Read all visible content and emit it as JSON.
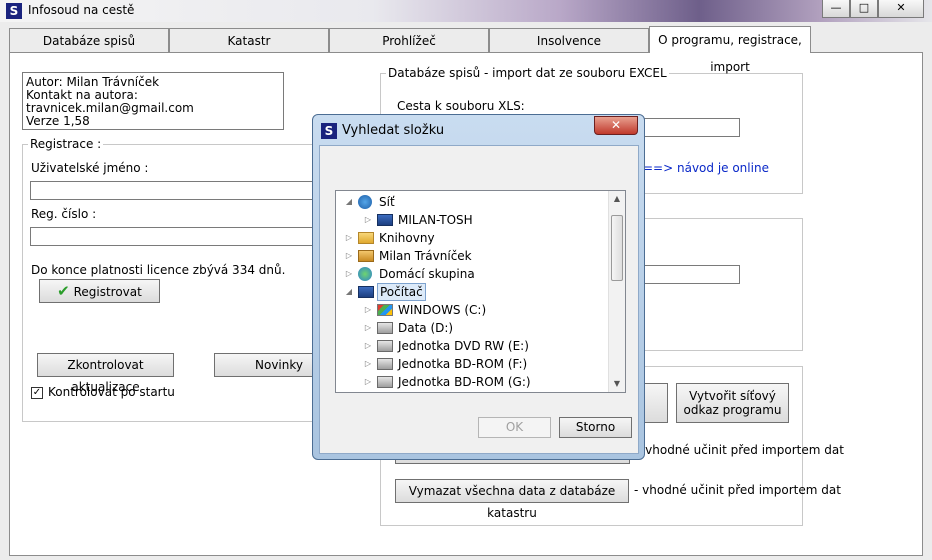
{
  "window": {
    "title": "Infosoud na cestě",
    "minimize": "—",
    "maximize": "□",
    "close": "✕"
  },
  "tabs": [
    {
      "label": "Databáze spisů"
    },
    {
      "label": "Katastr"
    },
    {
      "label": "Prohlížeč"
    },
    {
      "label": "Insolvence"
    },
    {
      "label": "O programu, registrace, import"
    }
  ],
  "about": {
    "line1": "Autor: Milan Trávníček",
    "line2": "Kontakt na autora: travnicek.milan@gmail.com",
    "line3": "Verze 1,58"
  },
  "registration": {
    "group_label": "Registrace :",
    "username_label": "Uživatelské jméno :",
    "username_value": "",
    "regnum_label": "Reg. číslo :",
    "regnum_value": "",
    "license_text": "Do konce platnosti licence zbývá 334 dnů.",
    "register_button": "Registrovat"
  },
  "updates": {
    "check_button": "Zkontrolovat aktualizace",
    "news_button": "Novinky",
    "check_on_start_label": "Kontrolovat po startu",
    "check_on_start": true
  },
  "import": {
    "group_label": "Databáze spisů - import dat ze souboru EXCEL",
    "path_label": "Cesta k souboru XLS:",
    "path_value": "",
    "help_link": "==> návod je online",
    "second_value": "",
    "network_link_button": "Vytvořit síťový odkaz programu",
    "hint_text": "- vhodné učinit před importem dat",
    "clear_cadastre_button": "Vymazat všechna data z databáze katastru",
    "clear_cadastre_hint": "- vhodné učinit před importem dat"
  },
  "dialog": {
    "title": "Vyhledat složku",
    "close": "✕",
    "tree": [
      {
        "label": "Síť",
        "indent": 0,
        "expanded": true,
        "icon": "network-icon",
        "selected": false
      },
      {
        "label": "MILAN-TOSH",
        "indent": 1,
        "expanded": false,
        "icon": "computer-icon",
        "selected": false
      },
      {
        "label": "Knihovny",
        "indent": 0,
        "expanded": false,
        "icon": "folder-icon",
        "selected": false
      },
      {
        "label": "Milan Trávníček",
        "indent": 0,
        "expanded": false,
        "icon": "user-folder-icon",
        "selected": false
      },
      {
        "label": "Domácí skupina",
        "indent": 0,
        "expanded": false,
        "icon": "homegroup-icon",
        "selected": false
      },
      {
        "label": "Počítač",
        "indent": 0,
        "expanded": true,
        "icon": "computer-icon",
        "selected": true
      },
      {
        "label": "WINDOWS (C:)",
        "indent": 1,
        "expanded": false,
        "icon": "windows-drive-icon",
        "selected": false
      },
      {
        "label": "Data (D:)",
        "indent": 1,
        "expanded": false,
        "icon": "drive-icon",
        "selected": false
      },
      {
        "label": "Jednotka DVD RW (E:)",
        "indent": 1,
        "expanded": false,
        "icon": "optical-drive-icon",
        "selected": false
      },
      {
        "label": "Jednotka BD-ROM (F:)",
        "indent": 1,
        "expanded": false,
        "icon": "optical-drive-icon",
        "selected": false
      },
      {
        "label": "Jednotka BD-ROM (G:)",
        "indent": 1,
        "expanded": false,
        "icon": "optical-drive-icon",
        "selected": false
      }
    ],
    "ok_button": "OK",
    "cancel_button": "Storno"
  }
}
